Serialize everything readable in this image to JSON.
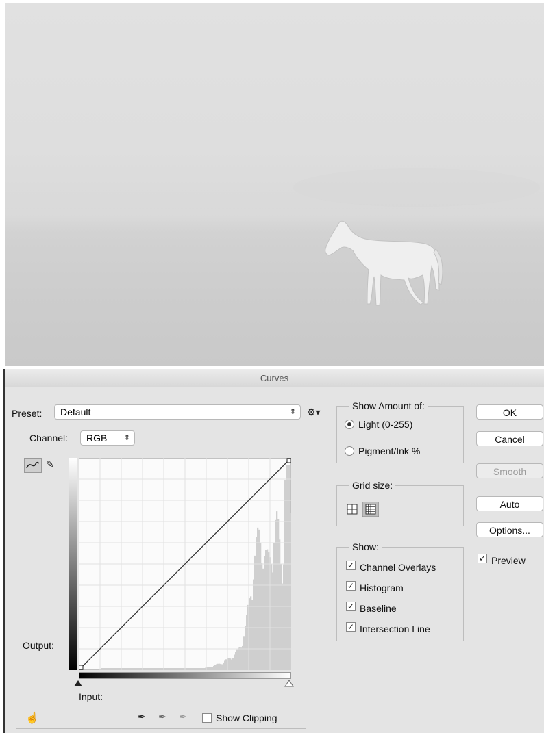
{
  "dialog": {
    "title": "Curves",
    "preset_label": "Preset:",
    "preset_value": "Default",
    "channel_label": "Channel:",
    "channel_value": "RGB",
    "output_label": "Output:",
    "input_label": "Input:",
    "show_clipping_label": "Show Clipping",
    "show_amount": {
      "legend": "Show Amount of:",
      "light_label": "Light  (0-255)",
      "pigment_label": "Pigment/Ink %",
      "selected": "light"
    },
    "grid_size": {
      "legend": "Grid size:"
    },
    "show": {
      "legend": "Show:",
      "items": [
        "Channel Overlays",
        "Histogram",
        "Baseline",
        "Intersection Line"
      ]
    },
    "buttons": {
      "ok": "OK",
      "cancel": "Cancel",
      "smooth": "Smooth",
      "auto": "Auto",
      "options": "Options..."
    },
    "preview_label": "Preview",
    "checkmark": "✓"
  },
  "icons": {
    "gear": "gear-icon",
    "curve_tool": "curve-point-icon",
    "pencil_tool": "pencil-icon",
    "black_eyedropper": "eyedropper-black-icon",
    "gray_eyedropper": "eyedropper-gray-icon",
    "white_eyedropper": "eyedropper-white-icon",
    "hand_tool": "target-adjust-hand-icon"
  }
}
